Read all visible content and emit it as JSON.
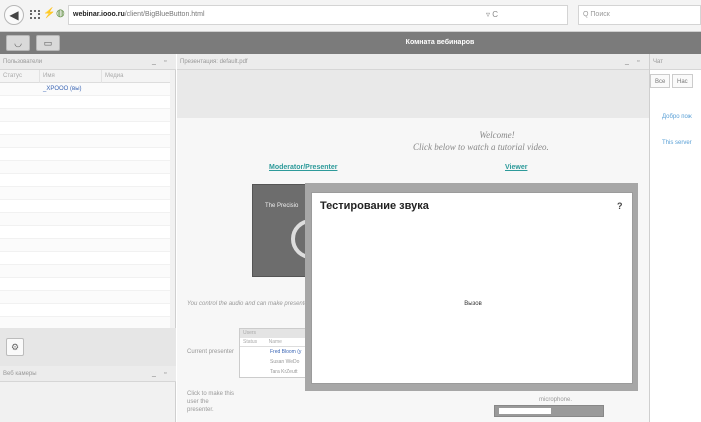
{
  "browser": {
    "back_glyph": "◀",
    "url_host": "webinar.iooo.ru",
    "url_path": "/client/BigBlueButton.html",
    "url_controls": "▿ C",
    "search_placeholder": "Q Поиск"
  },
  "toolbar": {
    "room_title": "Комната вебинаров"
  },
  "users_panel": {
    "title": "Пользователи",
    "columns": [
      "Статус",
      "Имя",
      "Медиа"
    ],
    "users": [
      {
        "name": "_XPOOO (вы)"
      }
    ],
    "empty_rows": 18
  },
  "webcams_panel": {
    "title": "Веб камеры"
  },
  "presentation": {
    "title": "Презентация: default.pdf",
    "welcome": "Welcome!",
    "click_below": "Click below to watch a tutorial video.",
    "link_moderator": "Moderator/Presenter",
    "link_viewer": "Viewer",
    "video_title": "The Precisio",
    "you_control": "You control the audio and can make presenter.",
    "mini_table": {
      "head": "Users",
      "columns": [
        "Status",
        "Name"
      ],
      "rows": [
        "Fred Bloom (y",
        "Susan WeDo",
        "Tara KrZeutt"
      ]
    },
    "hint_current": "Current presenter",
    "hint_click": "Click to make this user the presenter.",
    "hint_mic": "microphone."
  },
  "chat": {
    "title": "Чат",
    "tabs": [
      "Все",
      "Нас"
    ],
    "messages": [
      "Добро пож",
      "This server"
    ]
  },
  "dialog": {
    "title": "Тестирование звука",
    "help": "?",
    "call_label": "Вызов"
  },
  "colors": {
    "link_teal": "#2d9a9a",
    "user_blue": "#3b66b5",
    "toolbar_gray": "#7b7b7b"
  }
}
